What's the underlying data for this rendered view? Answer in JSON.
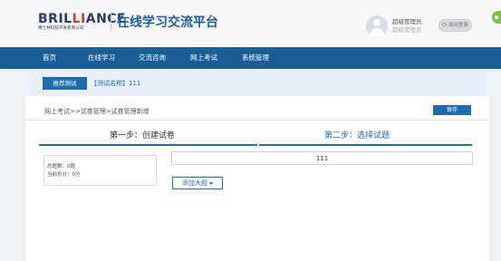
{
  "logo": {
    "part1": "BRIL",
    "part2": "LI",
    "part3": "ANCE",
    "subtitle": "博士林科技开发有限公司"
  },
  "platform_title": "在线学习交流平台",
  "user": {
    "role": "超级管理员",
    "name": "超级管理员"
  },
  "logout_label": "退出登录",
  "nav": {
    "items": [
      "首页",
      "在线学习",
      "交流咨询",
      "网上考试",
      "系统管理"
    ]
  },
  "strip": {
    "recommend_label": "推荐测试",
    "exam_name": "【测试名称】111"
  },
  "breadcrumb": "网上考试>>试卷管理>试卷管理新增",
  "save_label": "保存",
  "steps": {
    "step1": "第一步：创建试卷",
    "step2": "第二步：选择试题"
  },
  "summary": {
    "total_questions": "总题数：0题",
    "current_score": "当前总分：0分"
  },
  "paper_title_value": "111",
  "add_question_label": "添加大题",
  "colors": {
    "nav_bg": "#1a5e97",
    "accent": "#1f6cb4",
    "page_bg": "#eef1f4"
  }
}
